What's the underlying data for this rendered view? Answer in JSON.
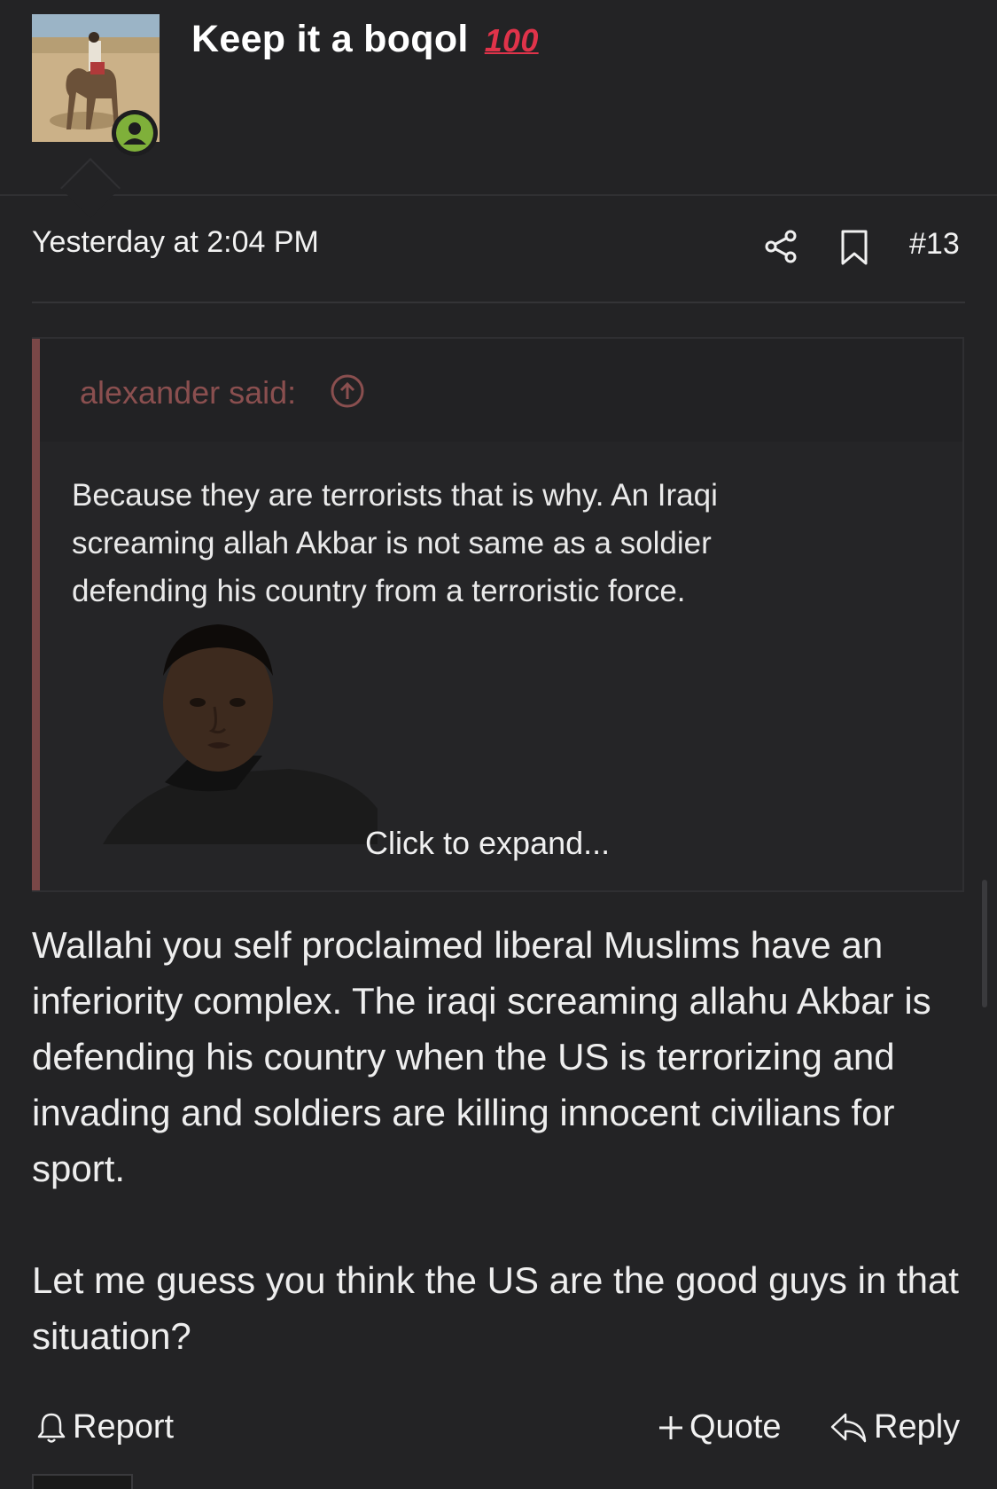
{
  "post": {
    "username": "Keep it a boqol",
    "username_emoji": "100",
    "timestamp": "Yesterday at 2:04 PM",
    "post_number": "#13"
  },
  "quote": {
    "author": "alexander said:",
    "text": "Because they are terrorists that is why. An Iraqi screaming allah Akbar is not same as a soldier defending his country from a terroristic force.",
    "expand_label": "Click to expand..."
  },
  "body": {
    "paragraph_1": "Wallahi you self proclaimed liberal Muslims have an inferiority complex. The iraqi screaming allahu Akbar is defending his country when the US is terrorizing and invading and soldiers are killing innocent civilians for sport.",
    "paragraph_2": "Let me guess you think the US are the good guys in that situation?"
  },
  "actions": {
    "report_label": "Report",
    "quote_label": "Quote",
    "reply_label": "Reply"
  },
  "colors": {
    "background": "#232325",
    "quote_accent": "#7a4747",
    "online_badge": "#7fb03a",
    "emoji_red": "#e0334a"
  },
  "icons": [
    "share-icon",
    "bookmark-icon",
    "arrow-up-circle-icon",
    "bell-icon",
    "plus-icon",
    "reply-icon",
    "online-status-icon"
  ]
}
